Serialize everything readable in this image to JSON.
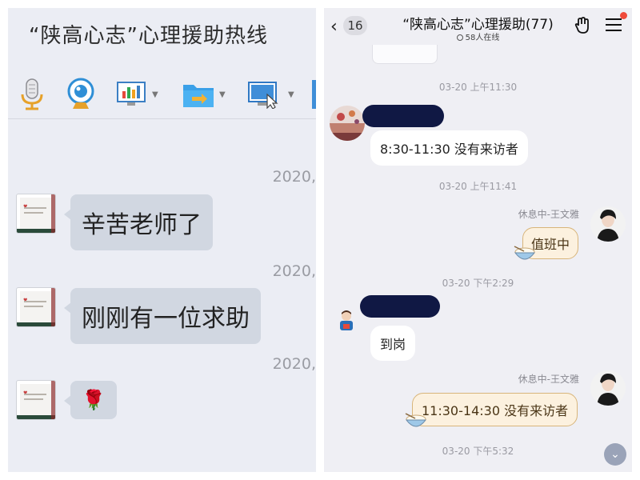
{
  "left_panel": {
    "title": "“陕高心志”心理援助热线",
    "toolbar": {
      "icons": [
        "microphone-icon",
        "webcam-icon",
        "monitor-chart-icon",
        "folder-arrow-icon",
        "screen-share-icon"
      ]
    },
    "date_partial": "2020,",
    "messages": [
      {
        "text": "辛苦老师了"
      },
      {
        "text": "刚刚有一位求助"
      },
      {
        "text": "🌹"
      }
    ]
  },
  "right_panel": {
    "header": {
      "back_count": "16",
      "group_title": "“陕高心志”心理援助(77)",
      "online": "58人在线"
    },
    "timestamps": {
      "t1": "03-20 上午11:30",
      "t2": "03-20 上午11:41",
      "t3": "03-20 下午2:29",
      "t4": "03-20 下午5:32"
    },
    "messages": {
      "m1": "8:30-11:30 没有来访者",
      "m2_sender": "休息中-王文雅",
      "m2": "值班中",
      "m3": "到岗",
      "m4_sender": "休息中-王文雅",
      "m4": "11:30-14:30 没有来访者"
    },
    "colors": {
      "redaction": "#101844",
      "own_bubble": "#fcf1df",
      "own_bubble_border": "#d8b57a",
      "notification_dot": "#ef4a3a"
    }
  }
}
